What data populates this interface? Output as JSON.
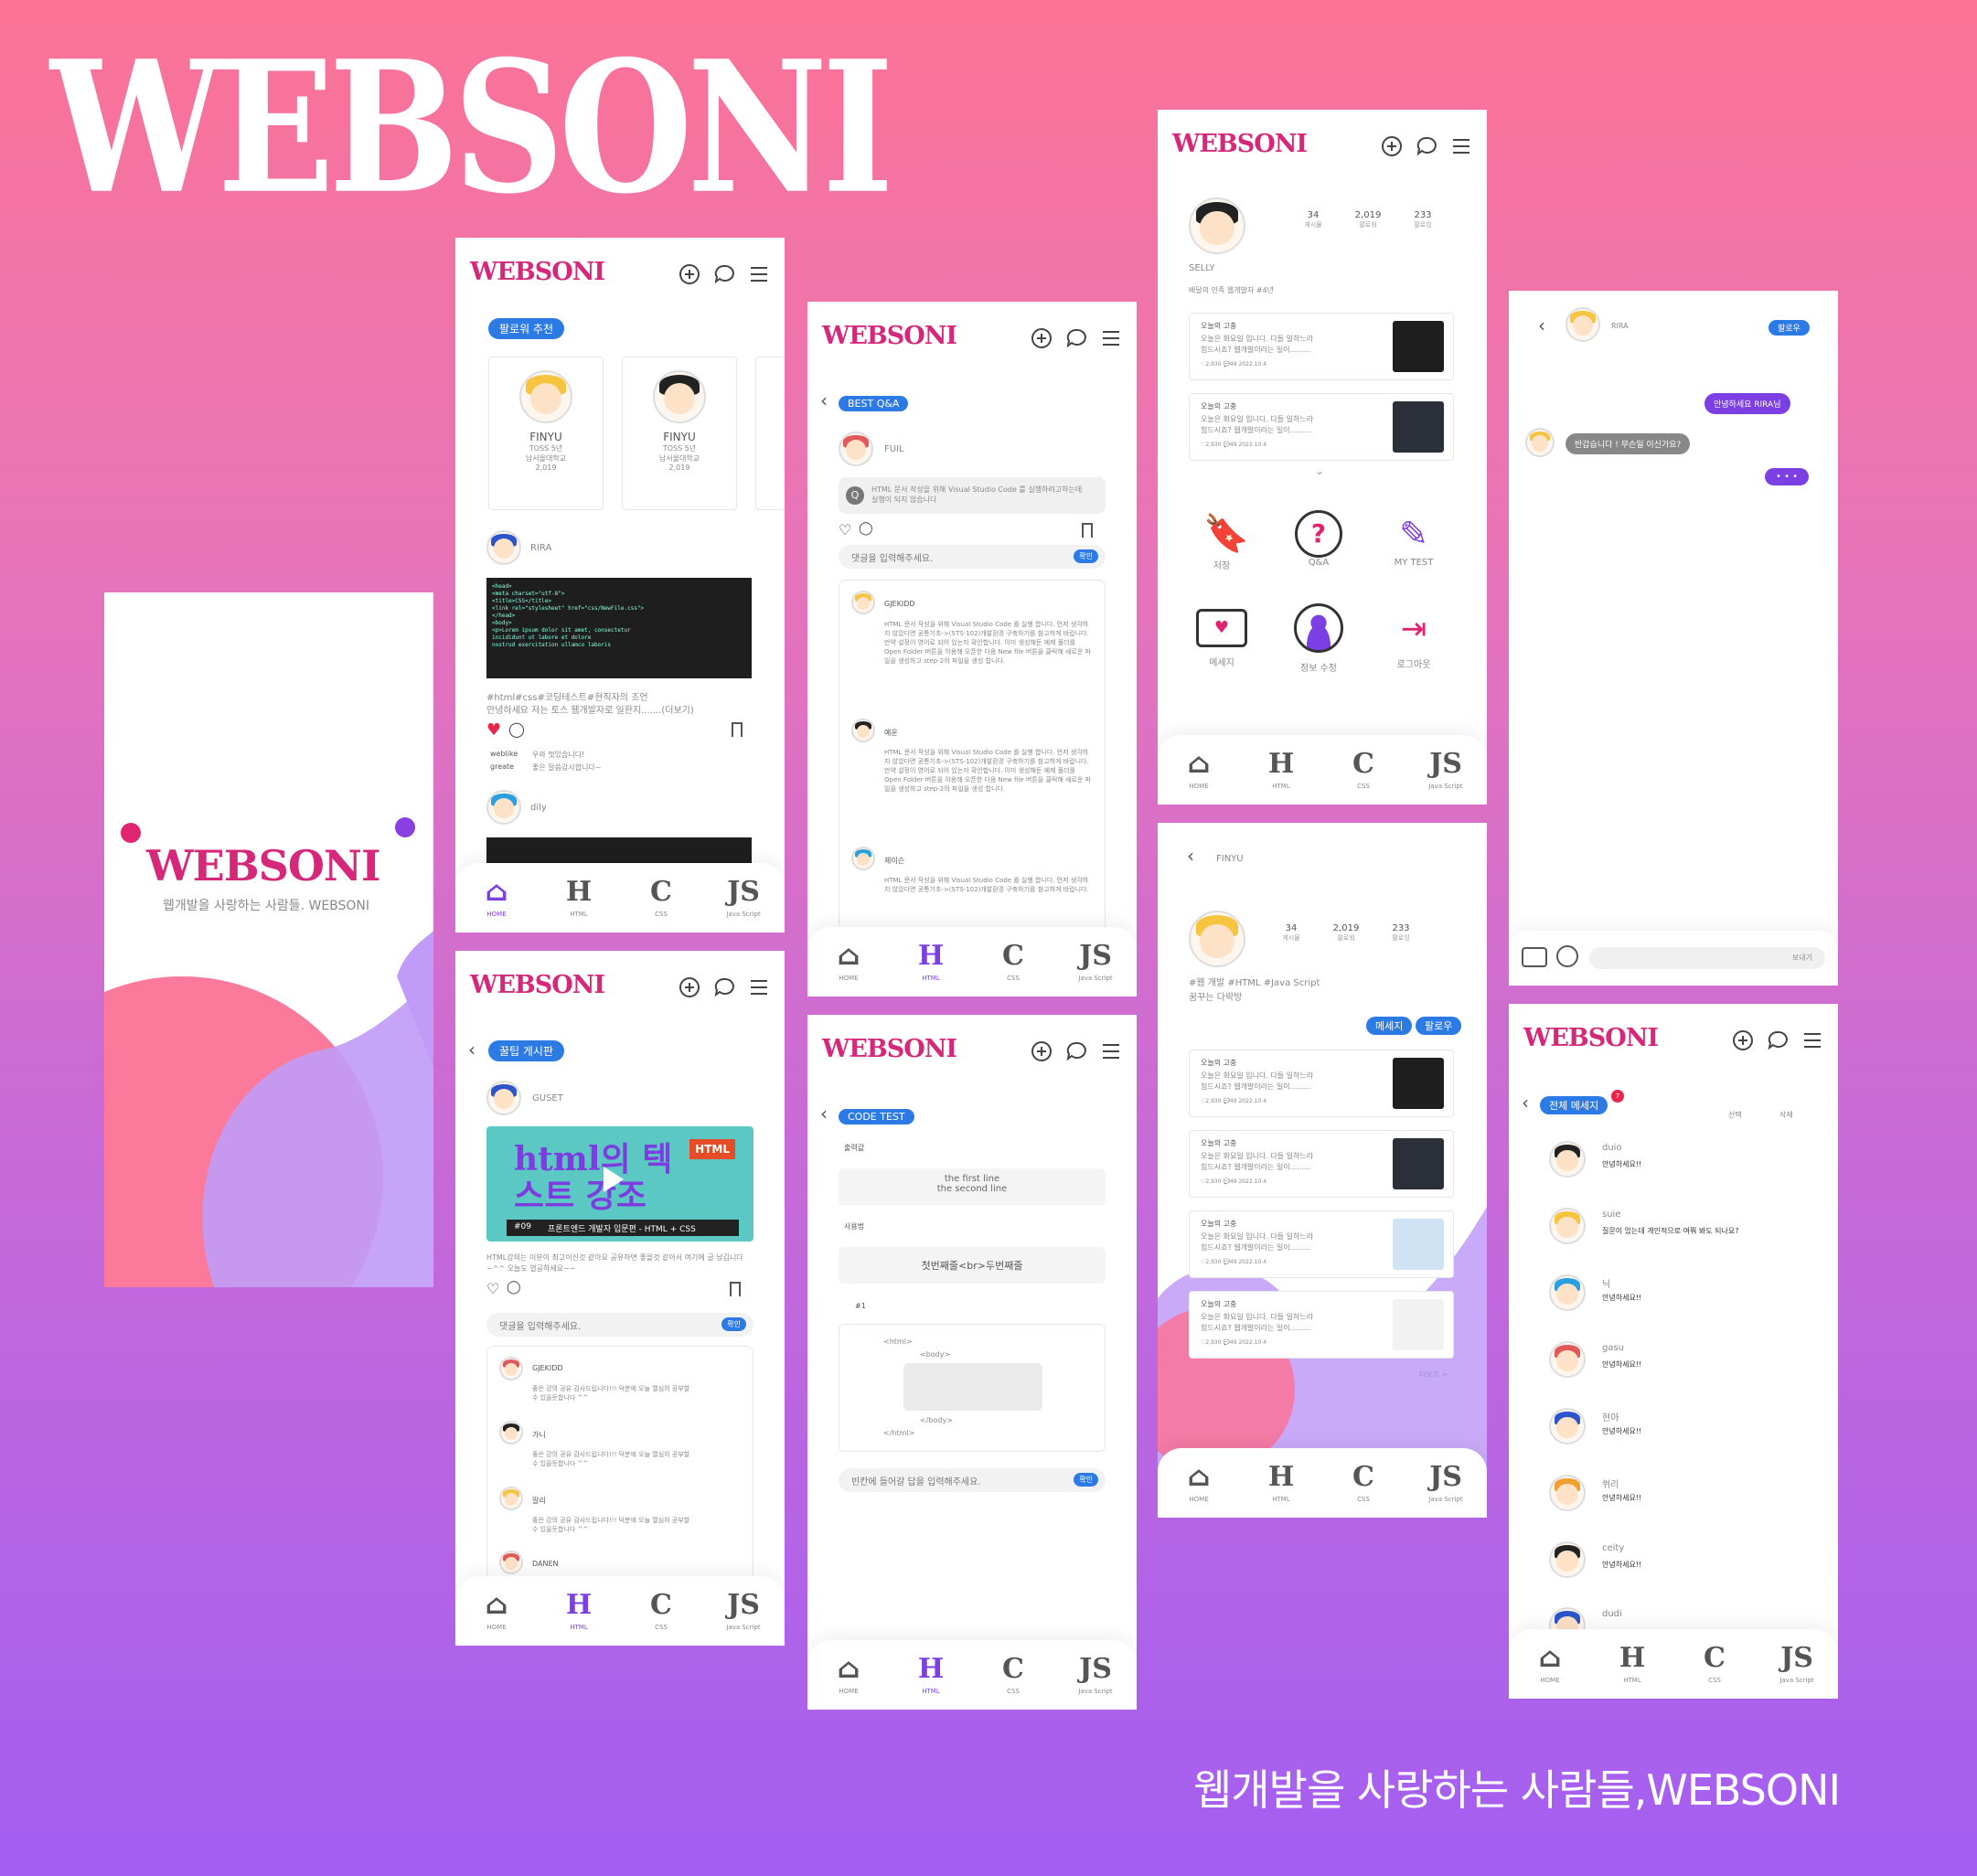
{
  "brand": {
    "logo": "WEBSONI",
    "tagline": "웹개발을 사랑하는 사람들,WEBSONI"
  },
  "splash": {
    "logo": "WEBSONI",
    "subtitle": "웹개발을 사랑하는 사람들. WEBSONI"
  },
  "nav": [
    "HOME",
    "HTML",
    "CSS",
    "Java Script"
  ],
  "feed": {
    "badge": "팔로워 추천",
    "recommend": [
      {
        "name": "FINYU",
        "school1": "TOSS 5년",
        "school2": "남서울대학교",
        "count": "2,019"
      },
      {
        "name": "FINYU",
        "school1": "TOSS 5년",
        "school2": "남서울대학교",
        "count": "2,019"
      }
    ],
    "post_user": "RIRA",
    "post_tags": "#html#css#코딩테스트#현직자의 조언",
    "post_text": "안녕하세요 저는 토스 웹개발자로 일한지.......(더보기)",
    "comments": [
      {
        "user": "weblike",
        "text": "우와 멋있습니다!"
      },
      {
        "user": "greate",
        "text": "좋은 말씀감사합니다~"
      }
    ],
    "next_user": "dily"
  },
  "tips": {
    "badge": "꿀팁 게시판",
    "user": "GUSET",
    "thumb_title": "html의 텍스트 강조",
    "thumb_badge": "HTML",
    "thumb_ep": "#09",
    "thumb_caption": "프론트엔드 개발자 입문편 - HTML + CSS",
    "text": "HTML강의는 이분이 최고이신것 같아요 공유하면 좋을것 같아서 여기에 글 남깁니다~^^ 오늘도 열공하세요~~",
    "input_placeholder": "댓글을 입력해주세요.",
    "ok": "확인",
    "comments": [
      {
        "user": "GJEKIDD",
        "text": "좋은 강의 공유 감사드립니다!!! 덕분에 오늘 열심히 공부할 수 있을듯합니다 ^^"
      },
      {
        "user": "가니",
        "text": "좋은 강의 공유 감사드립니다!!! 덕분에 오늘 열심히 공부할 수 있을듯합니다 ^^"
      },
      {
        "user": "말리",
        "text": "좋은 강의 공유 감사드립니다!!! 덕분에 오늘 열심히 공부할 수 있을듯합니다 ^^"
      },
      {
        "user": "DANEN",
        "text": ""
      }
    ]
  },
  "qa": {
    "badge": "BEST Q&A",
    "user": "FUIL",
    "question": "HTML 문서 작성을 위해 Visual Studio Code 를 실행하려고하는데 실행이 되지 않습니다",
    "input_placeholder": "댓글을 입력해주세요.",
    "ok": "확인",
    "answers": [
      {
        "user": "GJEKIDD",
        "text": "HTML 문서 작성을 위해 Visual Studio Code 를 실행 합니다. 먼저 생각하지 않았다면 공통기초->(STS-102)개발환경 구축하기를 참고하게 바랍니다. 만약 설정이 영어로 되어 있는지 확인합니다. 이미 생성해둔 예제 폴더를 Open Folder 버튼을 이용해 오픈한 다음 New file 버튼을 클릭해 새로운 파일을 생성하고 step-2의 파일을 생성 합니다."
      },
      {
        "user": "예운",
        "text": "HTML 문서 작성을 위해 Visual Studio Code 를 실행 합니다. 먼저 생각하지 않았다면 공통기초->(STS-102)개발환경 구축하기를 참고하게 바랍니다. 만약 설정이 영어로 되어 있는지 확인합니다. 이미 생성해둔 예제 폴더를 Open Folder 버튼을 이용해 오픈한 다음 New file 버튼을 클릭해 새로운 파일을 생성하고 step-2의 파일을 생성 합니다."
      },
      {
        "user": "제이슨",
        "text": "HTML 문서 작성을 위해 Visual Studio Code 를 실행 합니다. 먼저 생각하지 않았다면 공통기초->(STS-102)개발환경 구축하기를 참고하게 바랍니다."
      }
    ]
  },
  "codetest": {
    "badge": "CODE TEST",
    "output_label": "출력값",
    "output_line1": "the first line",
    "output_line2": "the second line",
    "usage_label": "사용법",
    "usage": "첫번째줄<br>두번째줄",
    "num": "#1",
    "html_open": "<html>",
    "body_open": "<body>",
    "body_close": "</body>",
    "html_close": "</html>",
    "input_placeholder": "빈칸에 들어갈 답을 입력해주세요.",
    "ok": "확인"
  },
  "mypage": {
    "stats": [
      {
        "v": "34",
        "l": "게시물"
      },
      {
        "v": "2,019",
        "l": "팔로워"
      },
      {
        "v": "233",
        "l": "팔로잉"
      }
    ],
    "name": "SELLY",
    "bio": "배달의 민족 웹개발자 #4년",
    "posts": [
      {
        "title": "오늘의 고충",
        "text1": "오늘은 화요일 입니다. 다들 일하느라",
        "text2": "힘드시죠? 웹개발이라는 일이.........",
        "meta": "♡2,930  💬49  2022.10.4"
      },
      {
        "title": "오늘의 고충",
        "text1": "오늘은 화요일 입니다. 다들 일하느라",
        "text2": "힘드시죠? 웹개발이라는 일이.........",
        "meta": "♡2,930  💬49  2022.10.4"
      }
    ],
    "menu": [
      "저장",
      "Q&A",
      "MY TEST",
      "메세지",
      "정보 수정",
      "로그아웃"
    ]
  },
  "profile": {
    "name": "FINYU",
    "stats": [
      {
        "v": "34",
        "l": "게시물"
      },
      {
        "v": "2,019",
        "l": "팔로워"
      },
      {
        "v": "233",
        "l": "팔로잉"
      }
    ],
    "bio1": "#웹 개발 #HTML #Java Script",
    "bio2": "꿈꾸는 다락방",
    "msg_btn": "메세지",
    "follow_btn": "팔로우",
    "posts": [
      {
        "title": "오늘의 고충",
        "text1": "오늘은 화요일 입니다. 다들 일하느라",
        "text2": "힘드시죠? 웹개발이라는 일이.........",
        "meta": "♡2,930  💬49  2022.10.4"
      },
      {
        "title": "오늘의 고충",
        "text1": "오늘은 화요일 입니다. 다들 일하느라",
        "text2": "힘드시죠? 웹개발이라는 일이.........",
        "meta": "♡2,930  💬49  2022.10.4"
      },
      {
        "title": "오늘의 고충",
        "text1": "오늘은 화요일 입니다. 다들 일하느라",
        "text2": "힘드시죠? 웹개발이라는 일이.........",
        "meta": "♡2,930  💬49  2022.10.4"
      },
      {
        "title": "오늘의 고충",
        "text1": "오늘은 화요일 입니다. 다들 일하느라",
        "text2": "힘드시죠? 웹개발이라는 일이.........",
        "meta": "♡2,930  💬49  2022.10.4"
      }
    ],
    "more": "더보기 >"
  },
  "chat": {
    "user": "RIRA",
    "follow": "팔로우",
    "sent": "안녕하세요 RIRA님",
    "received": "반갑습니다 ! 무슨일 이신가요?",
    "typing": "• • •",
    "send": "보내기"
  },
  "messages": {
    "badge": "전체 메세지",
    "notif": "7",
    "select": "선택",
    "delete": "삭제",
    "list": [
      {
        "name": "duio",
        "text": "안녕하세요!!"
      },
      {
        "name": "suie",
        "text": "질문이 있는데 개인적으로 여쭤 봐도 되나요?"
      },
      {
        "name": "닉",
        "text": "안녕하세요!!"
      },
      {
        "name": "gasu",
        "text": "안녕하세요!!"
      },
      {
        "name": "현아",
        "text": "안녕하세요!!"
      },
      {
        "name": "쒸리",
        "text": "안녕하세요!!"
      },
      {
        "name": "ceity",
        "text": "안녕하세요!!"
      },
      {
        "name": "dudi",
        "text": ""
      }
    ]
  }
}
